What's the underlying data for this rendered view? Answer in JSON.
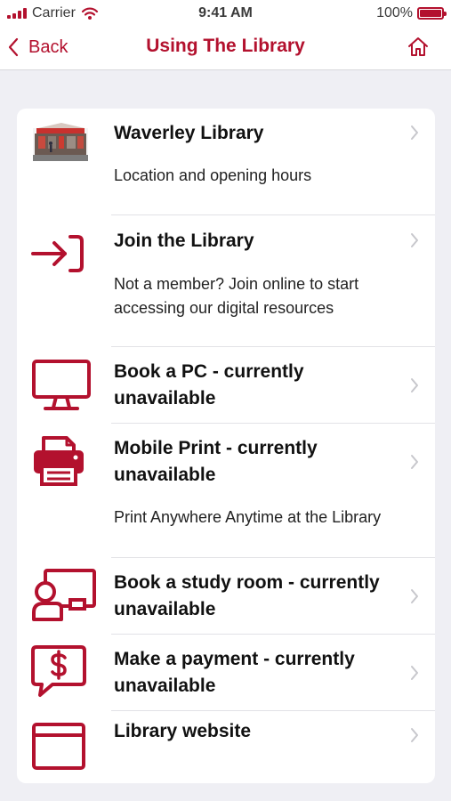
{
  "status_bar": {
    "carrier": "Carrier",
    "time": "9:41 AM",
    "battery": "100%"
  },
  "nav": {
    "back_label": "Back",
    "title": "Using The Library"
  },
  "colors": {
    "accent": "#b3112e",
    "background": "#efeff4"
  },
  "menu": [
    {
      "title": "Waverley Library",
      "subtitle": "Location and opening hours",
      "icon": "library-photo"
    },
    {
      "title": "Join the Library",
      "subtitle": "Not a member? Join online to start accessing our digital resources",
      "icon": "sign-in-icon"
    },
    {
      "title": "Book a PC - currently unavailable",
      "subtitle": "",
      "icon": "monitor-icon"
    },
    {
      "title": "Mobile Print - currently unavailable",
      "subtitle": "Print Anywhere Anytime at the Library",
      "icon": "printer-icon"
    },
    {
      "title": "Book a study room - currently unavailable",
      "subtitle": "",
      "icon": "study-room-icon"
    },
    {
      "title": "Make a payment - currently unavailable",
      "subtitle": "",
      "icon": "payment-icon"
    },
    {
      "title": "Library website",
      "subtitle": "",
      "icon": "browser-window-icon"
    }
  ]
}
